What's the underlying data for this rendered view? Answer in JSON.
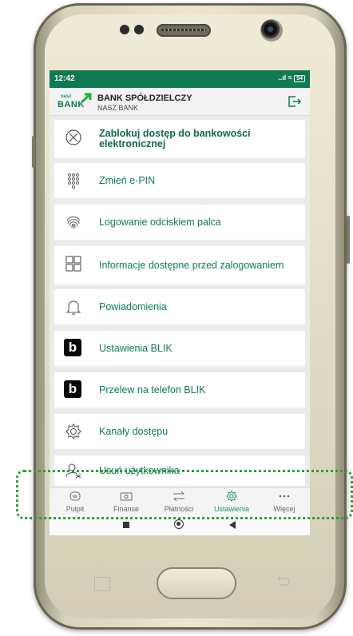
{
  "status_bar": {
    "time": "12:42",
    "signal": "..ıl",
    "battery": "54"
  },
  "header": {
    "bank_name": "BANK SPÓŁDZIELCZY",
    "bank_subtitle": "NASZ BANK",
    "logo_small": "nasz",
    "logo_big": "BANK"
  },
  "menu": {
    "items": [
      {
        "label": "Zablokuj dostęp do bankowości elektronicznej",
        "icon": "block-icon"
      },
      {
        "label": "Zmień e-PIN",
        "icon": "keypad-icon"
      },
      {
        "label": "Logowanie odciskiem palca",
        "icon": "fingerprint-icon"
      },
      {
        "label": "Informacje dostępne przed zalogowaniem",
        "icon": "grid-icon"
      },
      {
        "label": "Powiadomienia",
        "icon": "bell-icon"
      },
      {
        "label": "Ustawienia BLIK",
        "icon": "blik-icon"
      },
      {
        "label": "Przelew na telefon BLIK",
        "icon": "blik-icon"
      },
      {
        "label": "Kanały dostępu",
        "icon": "gear-icon"
      },
      {
        "label": "Usuń użytkownika",
        "icon": "remove-user-icon"
      }
    ]
  },
  "bottom_nav": {
    "items": [
      {
        "label": "Pulpit",
        "icon": "dashboard-icon"
      },
      {
        "label": "Finanse",
        "icon": "wallet-icon"
      },
      {
        "label": "Płatności",
        "icon": "transfer-icon"
      },
      {
        "label": "Ustawienia",
        "icon": "gear-icon",
        "active": true
      },
      {
        "label": "Więcej",
        "icon": "more-icon"
      }
    ]
  },
  "colors": {
    "brand": "#0f7a50",
    "accent": "#1a9960",
    "highlight": "#2f9e35"
  }
}
